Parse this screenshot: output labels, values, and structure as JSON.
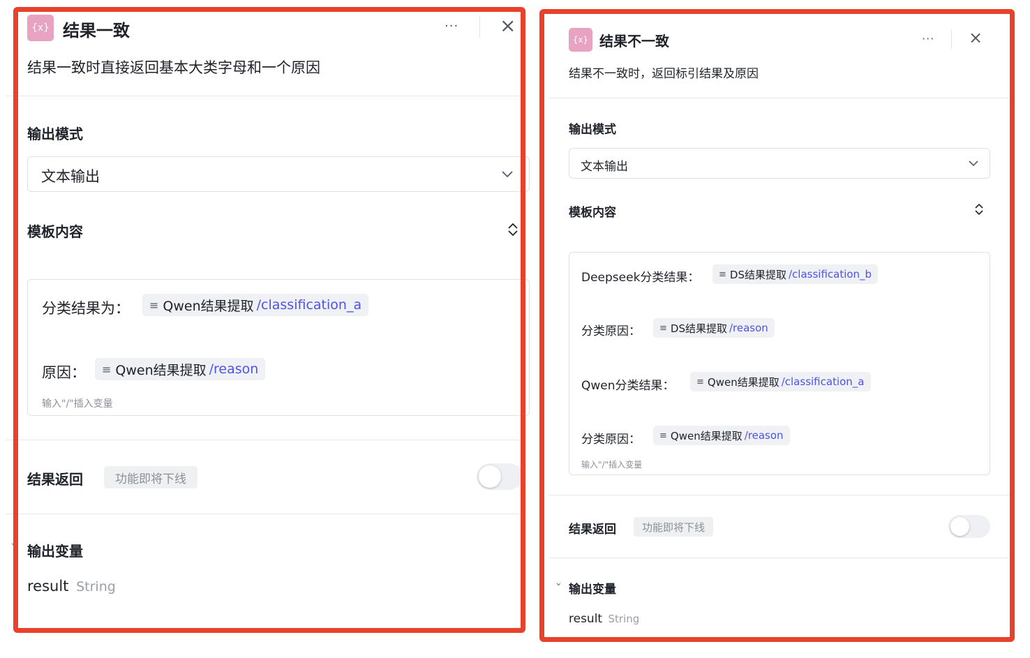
{
  "panels": [
    {
      "badge": "{x}",
      "title": "结果一致",
      "description": "结果一致时直接返回基本大类字母和一个原因",
      "more_label": "···",
      "close_label": "×",
      "output_mode": {
        "label": "输出模式",
        "value": "文本输出"
      },
      "template": {
        "label": "模板内容",
        "lines": [
          {
            "label": "分类结果为：",
            "chip_icon": "≡",
            "chip_node": "Qwen结果提取",
            "chip_var": "/classification_a"
          },
          {
            "label": "原因：",
            "chip_icon": "≡",
            "chip_node": "Qwen结果提取",
            "chip_var": "/reason"
          }
        ],
        "placeholder": "输入\"/\"插入变量"
      },
      "result_return": {
        "label": "结果返回",
        "tag": "功能即将下线",
        "enabled": false
      },
      "output_vars": {
        "label": "输出变量",
        "name": "result",
        "type": "String",
        "collapse_icon": "⌄"
      }
    },
    {
      "badge": "{x}",
      "title": "结果不一致",
      "description": "结果不一致时，返回标引结果及原因",
      "more_label": "···",
      "close_label": "×",
      "output_mode": {
        "label": "输出模式",
        "value": "文本输出"
      },
      "template": {
        "label": "模板内容",
        "lines": [
          {
            "label": "Deepseek分类结果：",
            "chip_icon": "≡",
            "chip_node": "DS结果提取",
            "chip_var": "/classification_b"
          },
          {
            "label": "分类原因：",
            "chip_icon": "≡",
            "chip_node": "DS结果提取",
            "chip_var": "/reason"
          },
          {
            "label": "Qwen分类结果：",
            "chip_icon": "≡",
            "chip_node": "Qwen结果提取",
            "chip_var": "/classification_a"
          },
          {
            "label": "分类原因：",
            "chip_icon": "≡",
            "chip_node": "Qwen结果提取",
            "chip_var": "/reason"
          }
        ],
        "placeholder": "输入\"/\"插入变量"
      },
      "result_return": {
        "label": "结果返回",
        "tag": "功能即将下线",
        "enabled": false
      },
      "output_vars": {
        "label": "输出变量",
        "name": "result",
        "type": "String",
        "collapse_icon": "⌄"
      }
    }
  ],
  "colors": {
    "highlight_border": "#e8412c",
    "badge_bg": "#e9a3c2",
    "variable_text": "#4d53e8",
    "chip_bg": "#f0f1f4"
  }
}
